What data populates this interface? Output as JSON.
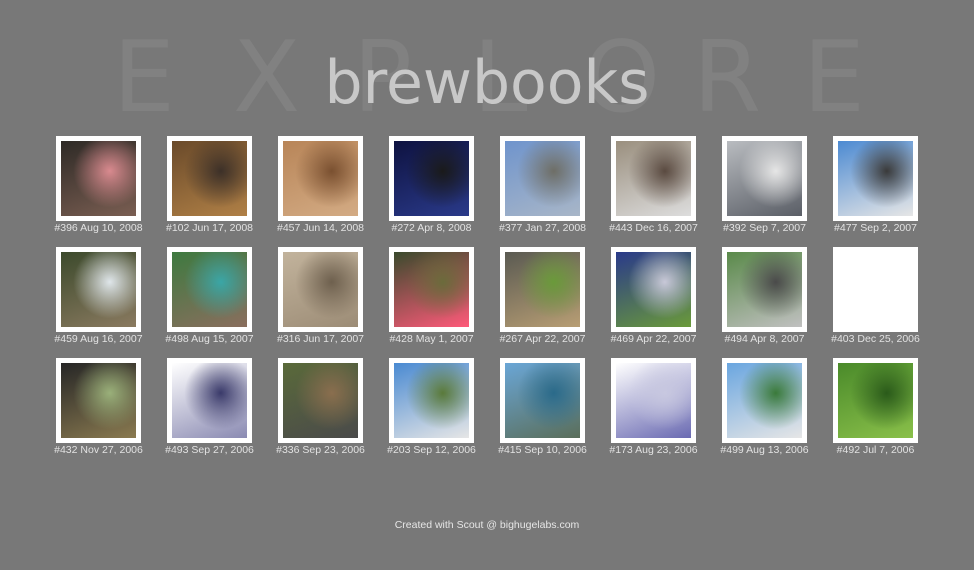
{
  "backdrop_letters": [
    "E",
    "X",
    "P",
    "L",
    "O",
    "R",
    "E"
  ],
  "title": "brewbooks",
  "photos": [
    {
      "caption": "#396 Aug 10, 2008",
      "colors": [
        "#2e2a26",
        "#7a5e52",
        "#d98a8f"
      ]
    },
    {
      "caption": "#102 Jun 17, 2008",
      "colors": [
        "#6a4a2a",
        "#b08046",
        "#3c3028"
      ]
    },
    {
      "caption": "#457 Jun 14, 2008",
      "colors": [
        "#b88558",
        "#d3ab84",
        "#7a5030"
      ]
    },
    {
      "caption": "#272 Apr 8, 2008",
      "colors": [
        "#0e1240",
        "#2a3a8a",
        "#1a1a1a"
      ]
    },
    {
      "caption": "#377 Jan 27, 2008",
      "colors": [
        "#6f94cc",
        "#a8b6c8",
        "#6e6e66"
      ]
    },
    {
      "caption": "#443 Dec 16, 2007",
      "colors": [
        "#9a8f7e",
        "#dddddd",
        "#5a4a40"
      ]
    },
    {
      "caption": "#392 Sep 7, 2007",
      "colors": [
        "#b9bcc0",
        "#5a5e66",
        "#e6e6e6"
      ]
    },
    {
      "caption": "#477 Sep 2, 2007",
      "colors": [
        "#4c8ad2",
        "#e6e6e6",
        "#3a3a3a"
      ]
    },
    {
      "caption": "#459 Aug 16, 2007",
      "colors": [
        "#3c4a2c",
        "#8a7a60",
        "#dfe6ea"
      ]
    },
    {
      "caption": "#498 Aug 15, 2007",
      "colors": [
        "#3e7a40",
        "#8a6e5e",
        "#3aa6a6"
      ]
    },
    {
      "caption": "#316 Jun 17, 2007",
      "colors": [
        "#c2b39c",
        "#9c8c76",
        "#6e604e"
      ]
    },
    {
      "caption": "#428 May 1, 2007",
      "colors": [
        "#3a4a2c",
        "#ff5a7a",
        "#6b6b3b"
      ]
    },
    {
      "caption": "#267 Apr 22, 2007",
      "colors": [
        "#5a5a52",
        "#b89e74",
        "#6a9a3a"
      ]
    },
    {
      "caption": "#469 Apr 22, 2007",
      "colors": [
        "#2a3a8a",
        "#6a9a3a",
        "#c8c8d8"
      ]
    },
    {
      "caption": "#494 Apr 8, 2007",
      "colors": [
        "#5a8a4a",
        "#c0c0c0",
        "#4a4a4a"
      ]
    },
    {
      "caption": "#403 Dec 25, 2006",
      "colors": [
        "#ffffff",
        "#ffffff",
        "#ffffff"
      ]
    },
    {
      "caption": "#432 Nov 27, 2006",
      "colors": [
        "#262626",
        "#8a7a50",
        "#9ab07a"
      ]
    },
    {
      "caption": "#493 Sep 27, 2006",
      "colors": [
        "#ffffff",
        "#8a8ab2",
        "#3a3a6a"
      ]
    },
    {
      "caption": "#336 Sep 23, 2006",
      "colors": [
        "#5a6a3a",
        "#4a4a4a",
        "#8a6e4e"
      ]
    },
    {
      "caption": "#203 Sep 12, 2006",
      "colors": [
        "#4a8ad2",
        "#e6e6e6",
        "#5a7a3a"
      ]
    },
    {
      "caption": "#415 Sep 10, 2006",
      "colors": [
        "#6aa6d6",
        "#5a6e5a",
        "#2a6a8a"
      ]
    },
    {
      "caption": "#173 Aug 23, 2006",
      "colors": [
        "#ffffff",
        "#6a6ab2",
        "#c8c8e0"
      ]
    },
    {
      "caption": "#499 Aug 13, 2006",
      "colors": [
        "#6aa6e0",
        "#e6e6e6",
        "#3a7a3a"
      ]
    },
    {
      "caption": "#492 Jul 7, 2006",
      "colors": [
        "#4a8a2a",
        "#8ac04a",
        "#2a5a1a"
      ]
    }
  ],
  "footer": "Created with Scout @ bighugelabs.com"
}
